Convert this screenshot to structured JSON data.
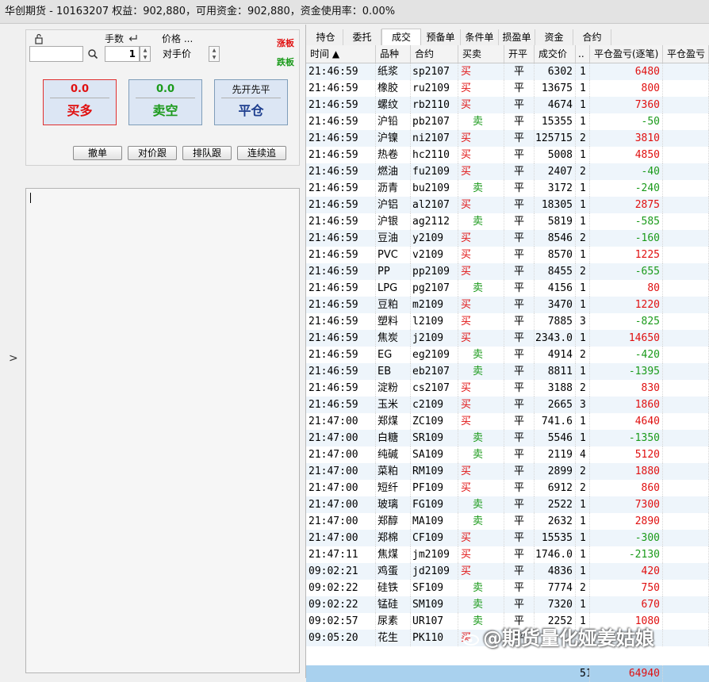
{
  "window": {
    "title": "华创期货 - 10163207  权益：902,880，可用资金：902,880，资金使用率：0.00%"
  },
  "order_panel": {
    "qty_label": "手数",
    "qty_value": "1",
    "price_label": "价格 ...",
    "price_type": "对手价",
    "limit_up": "涨板",
    "limit_down": "跌板",
    "buy": {
      "value": "0.0",
      "label": "买多"
    },
    "sell": {
      "value": "0.0",
      "label": "卖空"
    },
    "close": {
      "top": "先开先平",
      "label": "平仓"
    },
    "actions": [
      "撤单",
      "对价跟",
      "排队跟",
      "连续追"
    ]
  },
  "tabs": [
    "持仓",
    "委托",
    "成交",
    "预备单",
    "条件单",
    "损盈单",
    "资金",
    "合约"
  ],
  "active_tab": 2,
  "columns": [
    "时间 ▲",
    "品种",
    "合约",
    "买卖",
    "开平",
    "成交价",
    "..",
    "平仓盈亏(逐笔)",
    "平仓盈亏"
  ],
  "trades": [
    [
      "21:46:59",
      "纸浆",
      "sp2107",
      "买",
      "平",
      "6302",
      "1",
      "6480"
    ],
    [
      "21:46:59",
      "橡胶",
      "ru2109",
      "买",
      "平",
      "13675",
      "1",
      "800"
    ],
    [
      "21:46:59",
      "螺纹",
      "rb2110",
      "买",
      "平",
      "4674",
      "1",
      "7360"
    ],
    [
      "21:46:59",
      "沪铅",
      "pb2107",
      "卖",
      "平",
      "15355",
      "1",
      "-50"
    ],
    [
      "21:46:59",
      "沪镍",
      "ni2107",
      "买",
      "平",
      "125715",
      "2",
      "3810"
    ],
    [
      "21:46:59",
      "热卷",
      "hc2110",
      "买",
      "平",
      "5008",
      "1",
      "4850"
    ],
    [
      "21:46:59",
      "燃油",
      "fu2109",
      "买",
      "平",
      "2407",
      "2",
      "-40"
    ],
    [
      "21:46:59",
      "沥青",
      "bu2109",
      "卖",
      "平",
      "3172",
      "1",
      "-240"
    ],
    [
      "21:46:59",
      "沪铝",
      "al2107",
      "买",
      "平",
      "18305",
      "1",
      "2875"
    ],
    [
      "21:46:59",
      "沪银",
      "ag2112",
      "卖",
      "平",
      "5819",
      "1",
      "-585"
    ],
    [
      "21:46:59",
      "豆油",
      "y2109",
      "买",
      "平",
      "8546",
      "2",
      "-160"
    ],
    [
      "21:46:59",
      "PVC",
      "v2109",
      "买",
      "平",
      "8570",
      "1",
      "1225"
    ],
    [
      "21:46:59",
      "PP",
      "pp2109",
      "买",
      "平",
      "8455",
      "2",
      "-655"
    ],
    [
      "21:46:59",
      "LPG",
      "pg2107",
      "卖",
      "平",
      "4156",
      "1",
      "80"
    ],
    [
      "21:46:59",
      "豆粕",
      "m2109",
      "买",
      "平",
      "3470",
      "1",
      "1220"
    ],
    [
      "21:46:59",
      "塑料",
      "l2109",
      "买",
      "平",
      "7885",
      "3",
      "-825"
    ],
    [
      "21:46:59",
      "焦炭",
      "j2109",
      "买",
      "平",
      "2343.0",
      "1",
      "14650"
    ],
    [
      "21:46:59",
      "EG",
      "eg2109",
      "卖",
      "平",
      "4914",
      "2",
      "-420"
    ],
    [
      "21:46:59",
      "EB",
      "eb2107",
      "卖",
      "平",
      "8811",
      "1",
      "-1395"
    ],
    [
      "21:46:59",
      "淀粉",
      "cs2107",
      "买",
      "平",
      "3188",
      "2",
      "830"
    ],
    [
      "21:46:59",
      "玉米",
      "c2109",
      "买",
      "平",
      "2665",
      "3",
      "1860"
    ],
    [
      "21:47:00",
      "郑煤",
      "ZC109",
      "买",
      "平",
      "741.6",
      "1",
      "4640"
    ],
    [
      "21:47:00",
      "白糖",
      "SR109",
      "卖",
      "平",
      "5546",
      "1",
      "-1350"
    ],
    [
      "21:47:00",
      "纯碱",
      "SA109",
      "卖",
      "平",
      "2119",
      "4",
      "5120"
    ],
    [
      "21:47:00",
      "菜粕",
      "RM109",
      "买",
      "平",
      "2899",
      "2",
      "1880"
    ],
    [
      "21:47:00",
      "短纤",
      "PF109",
      "买",
      "平",
      "6912",
      "2",
      "860"
    ],
    [
      "21:47:00",
      "玻璃",
      "FG109",
      "卖",
      "平",
      "2522",
      "1",
      "7300"
    ],
    [
      "21:47:00",
      "郑醇",
      "MA109",
      "卖",
      "平",
      "2632",
      "1",
      "2890"
    ],
    [
      "21:47:00",
      "郑棉",
      "CF109",
      "买",
      "平",
      "15535",
      "1",
      "-300"
    ],
    [
      "21:47:11",
      "焦煤",
      "jm2109",
      "买",
      "平",
      "1746.0",
      "1",
      "-2130"
    ],
    [
      "09:02:21",
      "鸡蛋",
      "jd2109",
      "买",
      "平",
      "4836",
      "1",
      "420"
    ],
    [
      "09:02:22",
      "硅铁",
      "SF109",
      "卖",
      "平",
      "7774",
      "2",
      "750"
    ],
    [
      "09:02:22",
      "锰硅",
      "SM109",
      "卖",
      "平",
      "7320",
      "1",
      "670"
    ],
    [
      "09:02:57",
      "尿素",
      "UR107",
      "卖",
      "平",
      "2252",
      "1",
      "1080"
    ],
    [
      "09:05:20",
      "花生",
      "PK110",
      "买",
      "平",
      "",
      "",
      ""
    ]
  ],
  "totals": {
    "qty": "51",
    "pnl": "64940"
  },
  "watermark": "@期货量化娅姜姑娘",
  "colors": {
    "buy": "#e01010",
    "sell": "#1a9a1a",
    "total_row": "#a9d1ee",
    "alt_row": "#eef5fb"
  }
}
